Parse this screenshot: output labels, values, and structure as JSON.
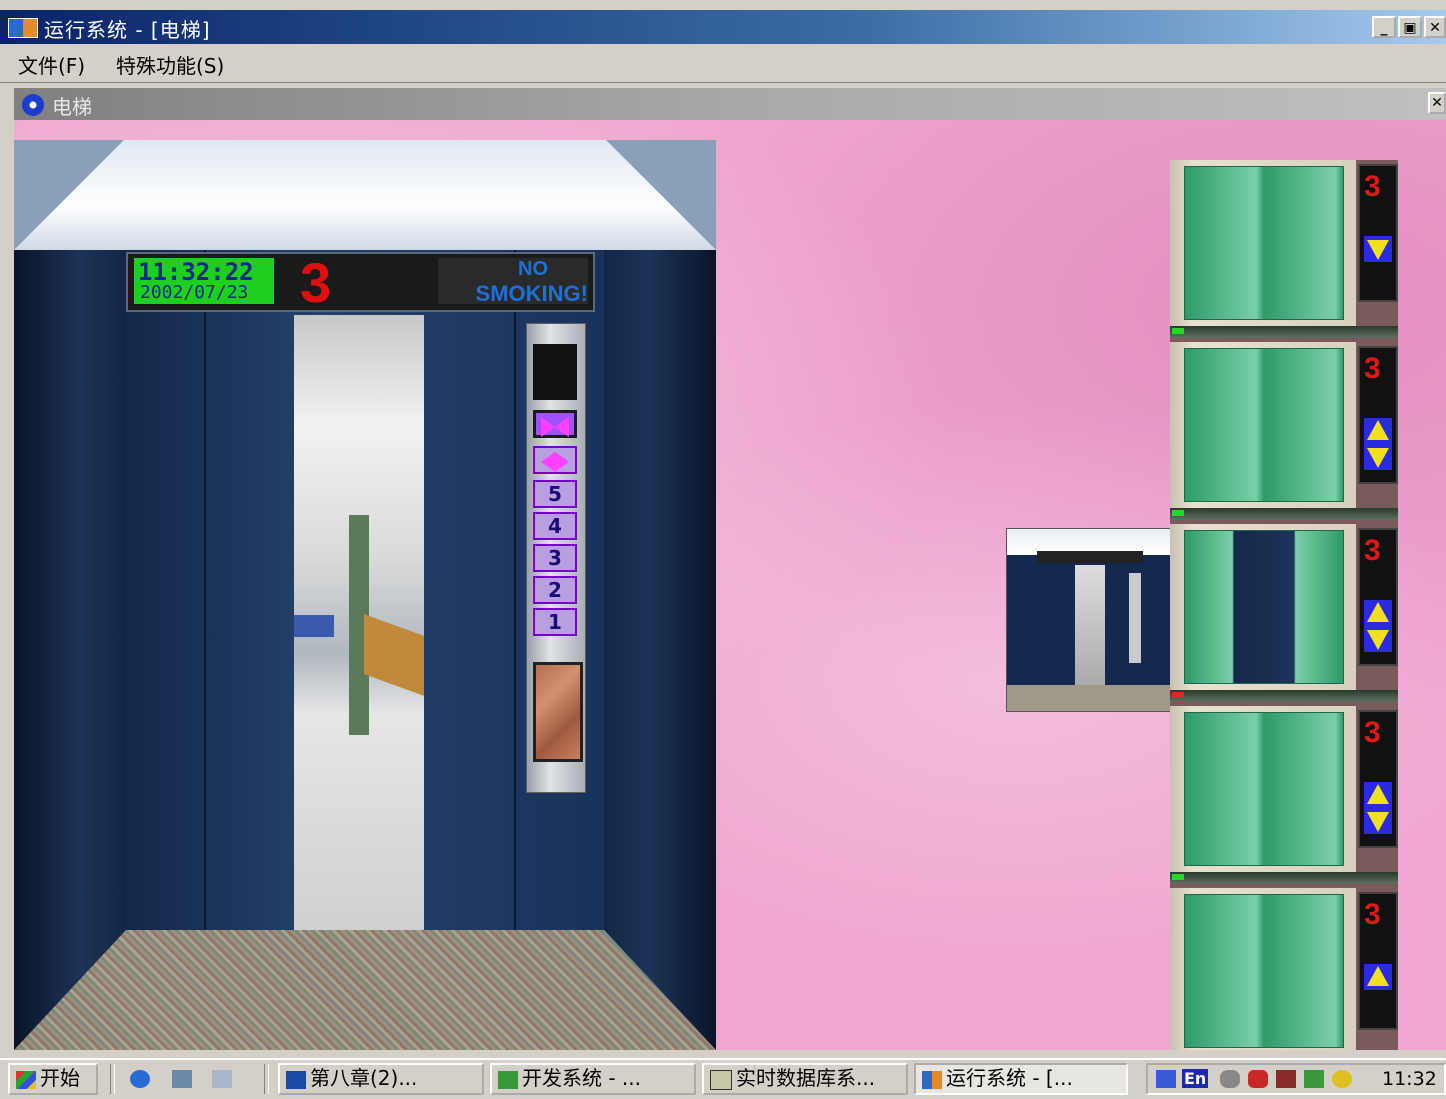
{
  "window": {
    "title": "运行系统 - [电梯]",
    "buttons": {
      "minimize": "_",
      "restore": "🗗",
      "close": "×"
    }
  },
  "menu": {
    "items": [
      {
        "label": "文件(F)"
      },
      {
        "label": "特殊功能(S)"
      }
    ]
  },
  "child": {
    "title": "电梯",
    "close": "×"
  },
  "cabin": {
    "time": "11:32:22",
    "date": "2002/07/23",
    "floor": "3",
    "notice_line1": "NO",
    "notice_line2": "SMOKING!",
    "buttons": [
      "5",
      "4",
      "3",
      "2",
      "1"
    ]
  },
  "landings": [
    {
      "floor_display": "3",
      "arrows": "down",
      "door": "closed"
    },
    {
      "floor_display": "3",
      "arrows": "up-down",
      "door": "closed"
    },
    {
      "floor_display": "3",
      "arrows": "up-down",
      "door": "open"
    },
    {
      "floor_display": "3",
      "arrows": "up-down",
      "door": "closed"
    },
    {
      "floor_display": "3",
      "arrows": "up",
      "door": "closed"
    }
  ],
  "taskbar": {
    "start": "开始",
    "tasks": [
      {
        "label": "第八章(2)..."
      },
      {
        "label": "开发系统 - ..."
      },
      {
        "label": "实时数据库系..."
      },
      {
        "label": "运行系统 - [..."
      }
    ],
    "tray_lang": "En",
    "clock": "11:32"
  }
}
